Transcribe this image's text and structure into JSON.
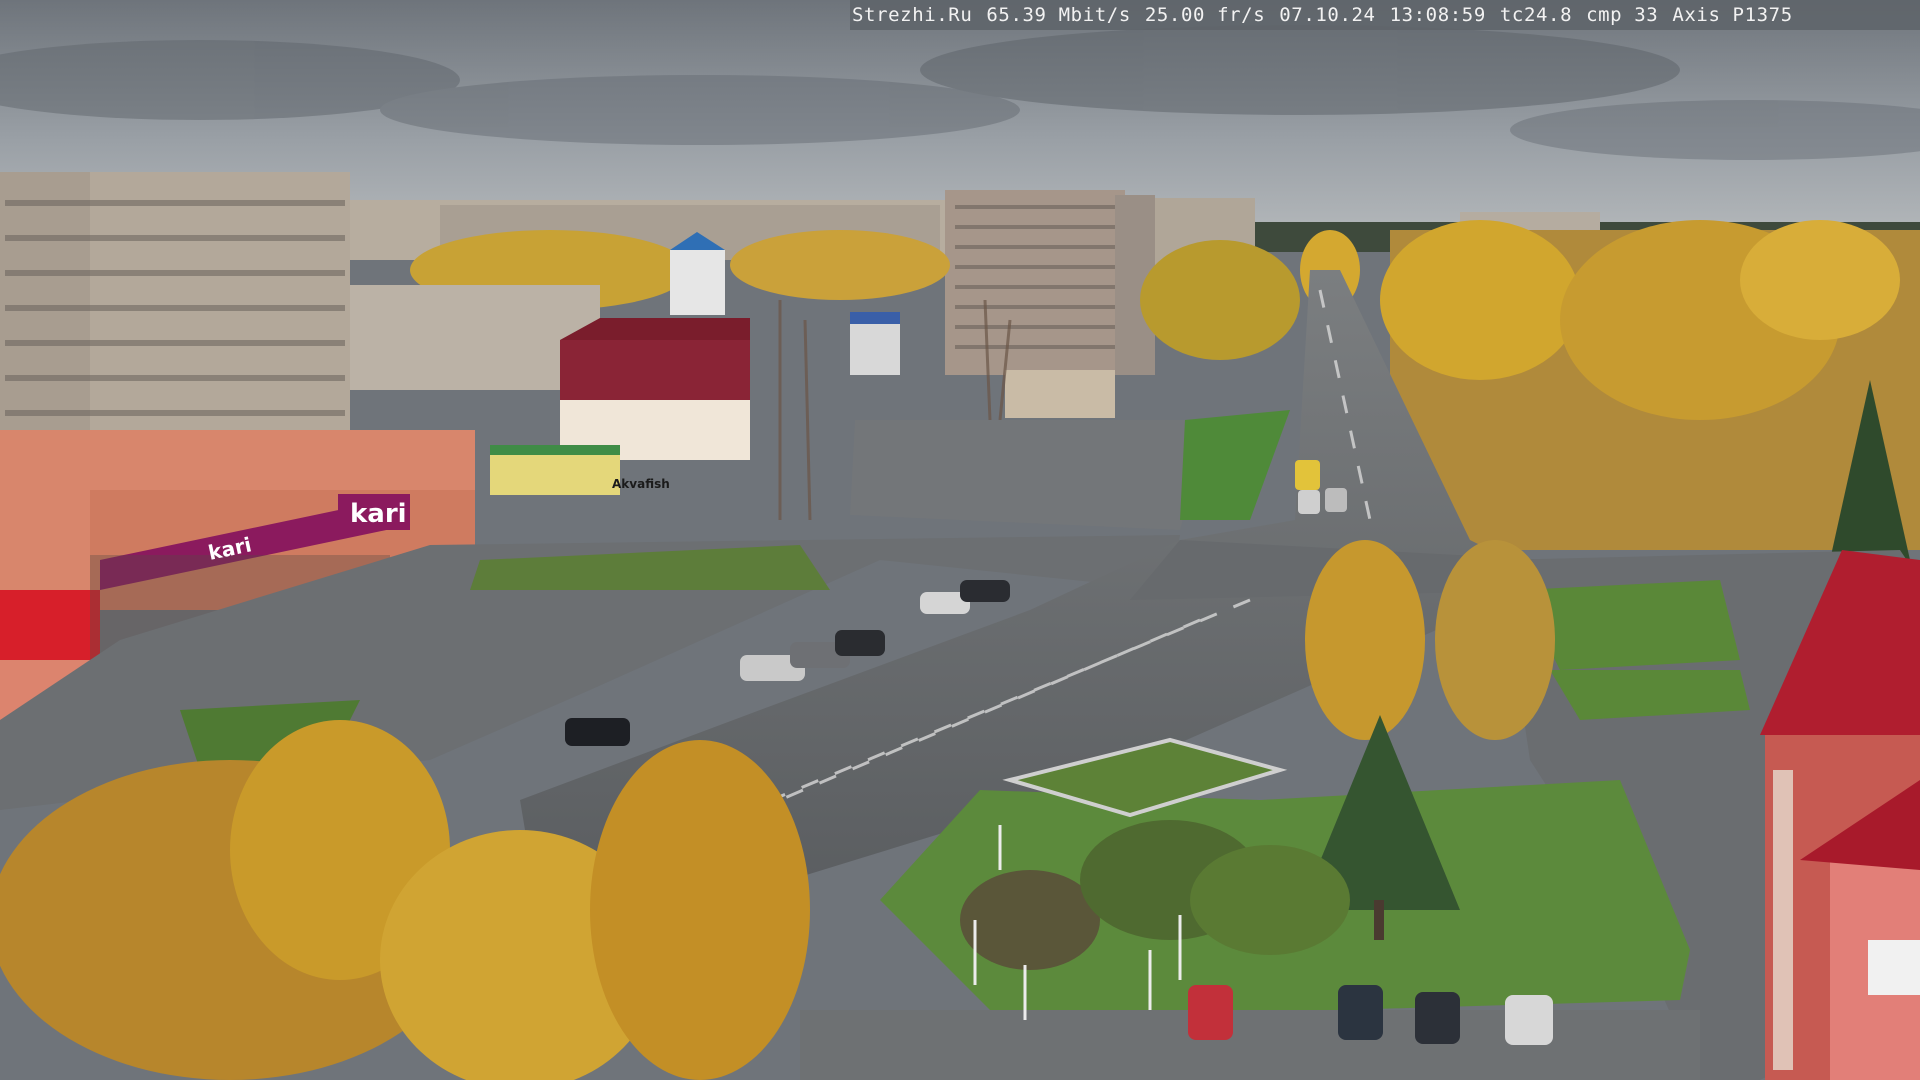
{
  "overlay": {
    "site": "Strezhi.Ru",
    "bitrate": "65.39 Mbit/s",
    "framerate": "25.00 fr/s",
    "date": "07.10.24",
    "time": "13:08:59",
    "tc": "tc24.8",
    "cmp": "cmp 33",
    "camera_model": "Axis P1375"
  },
  "signs": {
    "store_main": "kari",
    "store_side": "kari",
    "billboard": "Akvafish"
  },
  "colors": {
    "sky": "#8e959c",
    "road": "#5e6164",
    "grass": "#5d8a3a",
    "foliage": "#c99a2a",
    "kari_brand": "#8b1a5e"
  }
}
